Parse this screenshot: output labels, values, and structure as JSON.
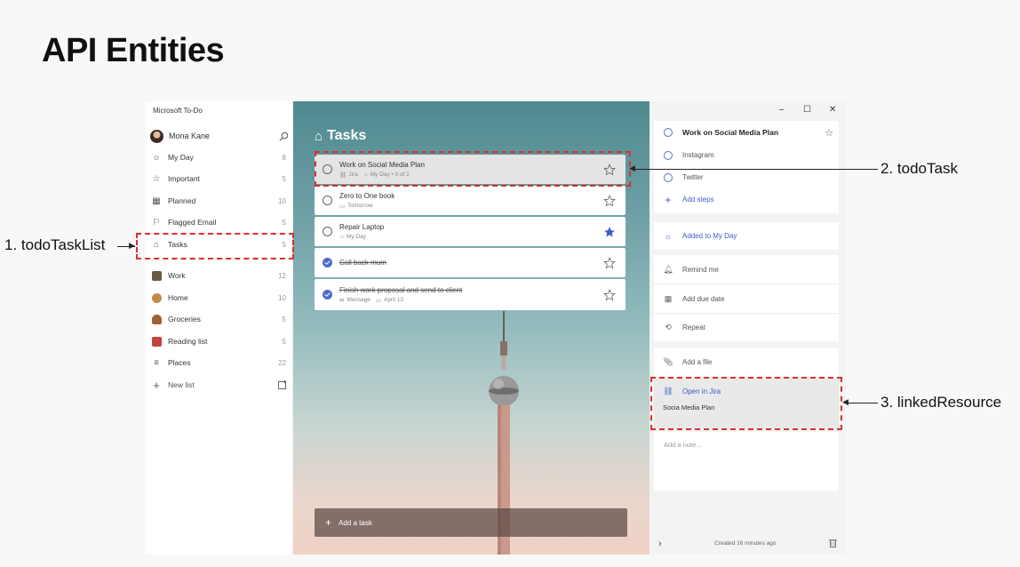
{
  "slide": {
    "title": "API Entities"
  },
  "app": {
    "name": "Microsoft To-Do"
  },
  "sidebar": {
    "user": "Mona Kane",
    "items": [
      {
        "label": "My Day",
        "count": "8",
        "icon": "sun-icon"
      },
      {
        "label": "Important",
        "count": "5",
        "icon": "star-icon"
      },
      {
        "label": "Planned",
        "count": "10",
        "icon": "calendar-icon"
      },
      {
        "label": "Flagged Email",
        "count": "5",
        "icon": "flag-icon"
      },
      {
        "label": "Tasks",
        "count": "5",
        "icon": "home-icon"
      },
      {
        "label": "Work",
        "count": "12",
        "icon": "work-icon"
      },
      {
        "label": "Home",
        "count": "10",
        "icon": "home-list-icon"
      },
      {
        "label": "Groceries",
        "count": "5",
        "icon": "groceries-icon"
      },
      {
        "label": "Reading list",
        "count": "5",
        "icon": "book-icon"
      },
      {
        "label": "Places",
        "count": "22",
        "icon": "list-icon"
      }
    ],
    "new_list": "New list"
  },
  "tasks": {
    "title": "Tasks",
    "items": [
      {
        "title": "Work on Social Media Plan",
        "meta1": "Jira",
        "meta2": "My Day • 0 of 2",
        "starred": false,
        "done": false
      },
      {
        "title": "Zero to One book",
        "meta1": "Tomorrow",
        "starred": false,
        "done": false
      },
      {
        "title": "Repair Laptop",
        "meta1": "My Day",
        "starred": true,
        "done": false
      },
      {
        "title": "Call back mum",
        "starred": false,
        "done": true
      },
      {
        "title": "Finish work proposal and send to client",
        "meta1": "Message",
        "meta2": "April 13",
        "starred": false,
        "done": true
      }
    ],
    "add_task": "Add a task"
  },
  "detail": {
    "task_title": "Work on Social Media Plan",
    "steps": [
      "Instagram",
      "Twitter"
    ],
    "add_steps": "Add steps",
    "added_to_my_day": "Added to My Day",
    "remind_me": "Remind me",
    "add_due_date": "Add due date",
    "repeat": "Repeat",
    "add_file": "Add a file",
    "open_in_jira": "Open in Jira",
    "linked_name": "Socia Media Plan",
    "note_placeholder": "Add a note...",
    "created": "Created 16 minutes ago"
  },
  "annotations": {
    "a1": "1. todoTaskList",
    "a2": "2. todoTask",
    "a3": "3. linkedResource"
  },
  "colors": {
    "accent": "#4f6bc8",
    "annotation_red": "#d93030"
  }
}
